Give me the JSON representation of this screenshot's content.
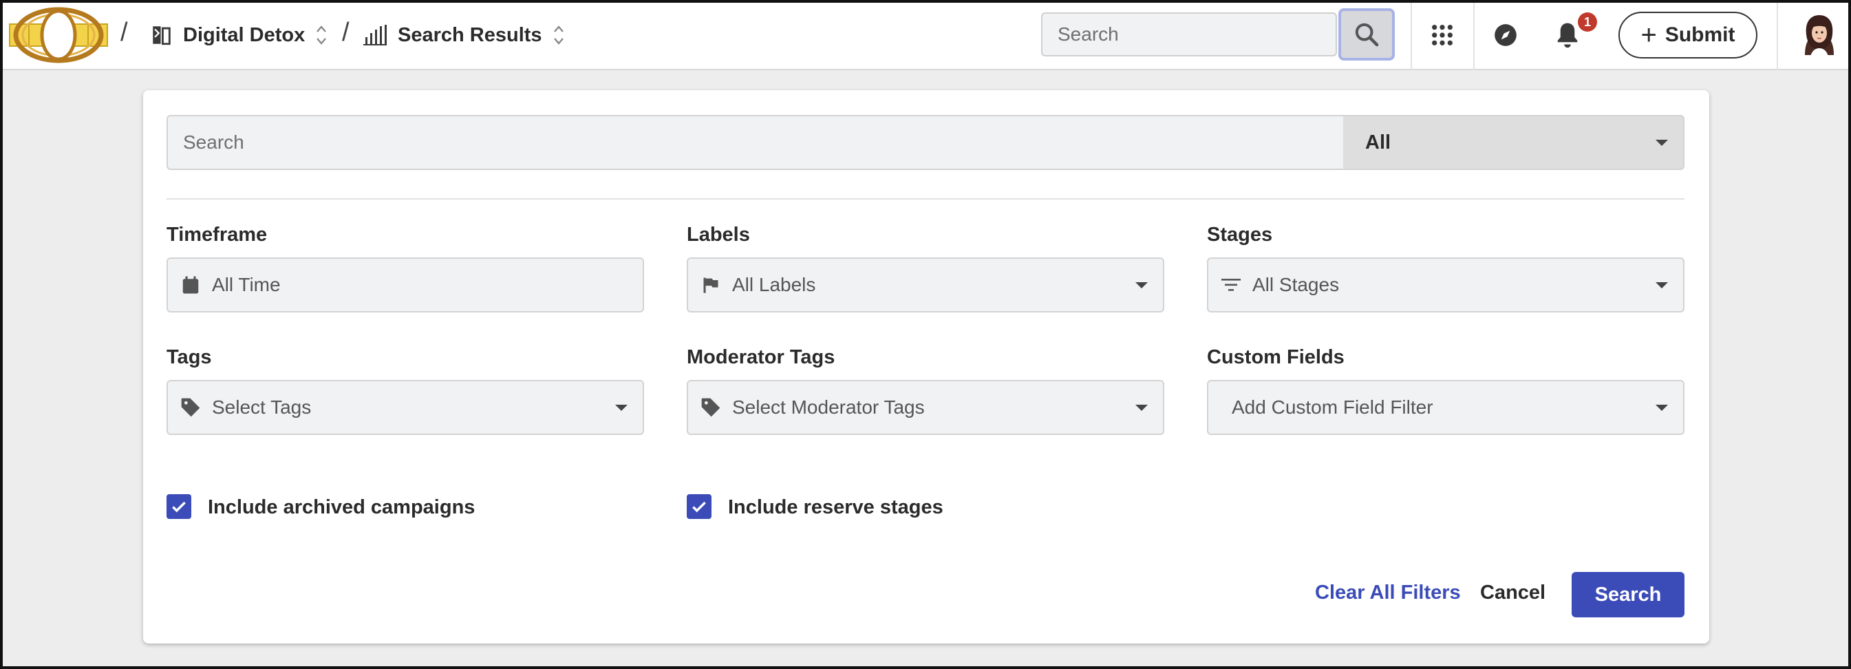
{
  "header": {
    "breadcrumb": [
      {
        "label": "Digital Detox",
        "icon": "campaign-icon"
      },
      {
        "label": "Search Results",
        "icon": "bar-chart-icon"
      }
    ],
    "separator": "/",
    "search_placeholder": "Search",
    "notification_count": "1",
    "submit_label": "Submit",
    "icons": [
      "apps-grid-icon",
      "compass-icon",
      "bell-icon"
    ]
  },
  "filters": {
    "search_placeholder": "Search",
    "scope_value": "All",
    "timeframe": {
      "label": "Timeframe",
      "value": "All Time",
      "icon": "calendar-icon"
    },
    "labels": {
      "label": "Labels",
      "value": "All Labels",
      "icon": "flag-icon"
    },
    "stages": {
      "label": "Stages",
      "value": "All Stages",
      "icon": "filter-lines-icon"
    },
    "tags": {
      "label": "Tags",
      "value": "Select Tags",
      "icon": "tag-icon"
    },
    "moderator_tags": {
      "label": "Moderator Tags",
      "value": "Select Moderator Tags",
      "icon": "tag-icon"
    },
    "custom_fields": {
      "label": "Custom Fields",
      "value": "Add Custom Field Filter"
    },
    "include_archived": {
      "label": "Include archived campaigns",
      "checked": true
    },
    "include_reserve": {
      "label": "Include reserve stages",
      "checked": true
    }
  },
  "actions": {
    "clear_label": "Clear All Filters",
    "cancel_label": "Cancel",
    "search_label": "Search"
  },
  "colors": {
    "accent": "#3b4bb8",
    "badge": "#c0392b",
    "input_bg": "#f1f2f4",
    "page_bg": "#ededed"
  }
}
